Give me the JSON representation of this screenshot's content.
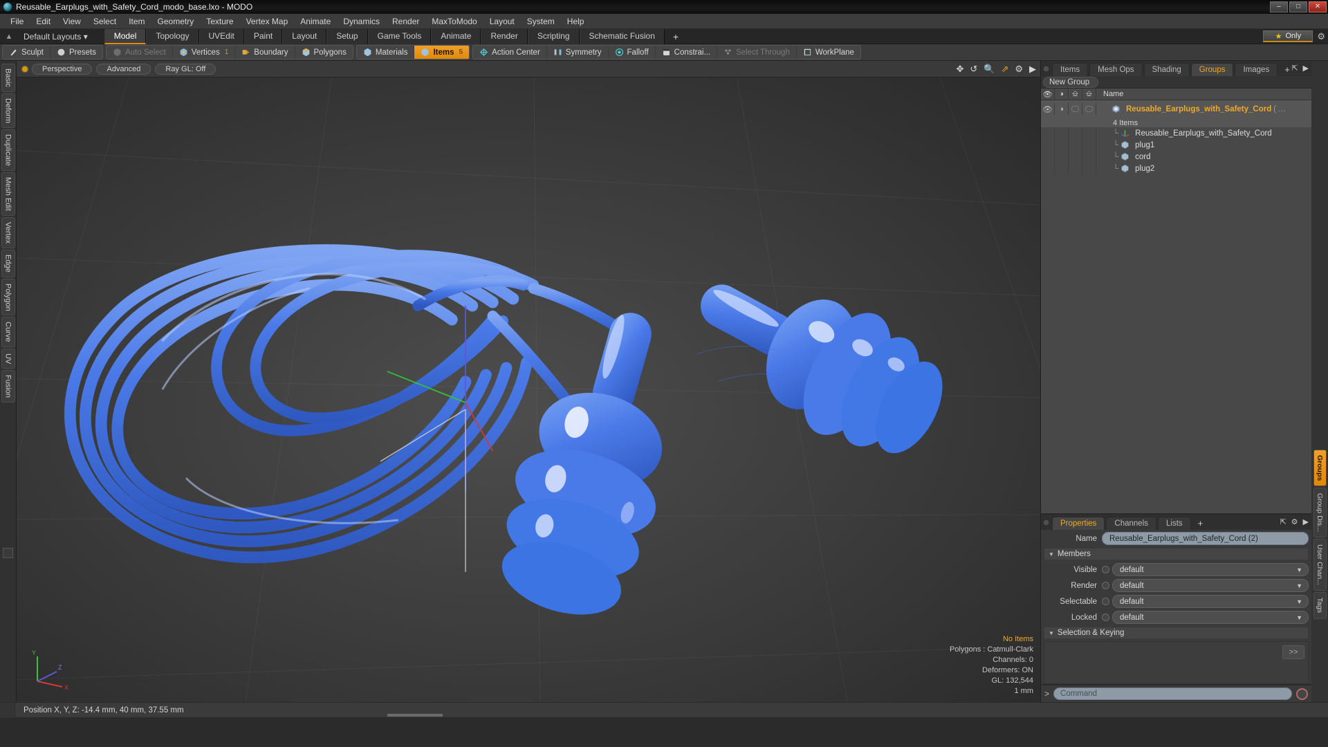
{
  "window": {
    "title": "Reusable_Earplugs_with_Safety_Cord_modo_base.lxo - MODO",
    "app_icon": "modo-logo-icon",
    "buttons": {
      "minimize": "–",
      "maximize": "□",
      "close": "✕"
    }
  },
  "menubar": {
    "items": [
      "File",
      "Edit",
      "View",
      "Select",
      "Item",
      "Geometry",
      "Texture",
      "Vertex Map",
      "Animate",
      "Dynamics",
      "Render",
      "MaxToModo",
      "Layout",
      "System",
      "Help"
    ]
  },
  "layoutbar": {
    "anchor_icon": "anchor-pin-icon",
    "default_layouts": "Default Layouts",
    "dropdown_caret": "▾",
    "tabs": [
      {
        "label": "Model",
        "active": true
      },
      {
        "label": "Topology",
        "active": false
      },
      {
        "label": "UVEdit",
        "active": false
      },
      {
        "label": "Paint",
        "active": false
      },
      {
        "label": "Layout",
        "active": false
      },
      {
        "label": "Setup",
        "active": false
      },
      {
        "label": "Game Tools",
        "active": false
      },
      {
        "label": "Animate",
        "active": false
      },
      {
        "label": "Render",
        "active": false
      },
      {
        "label": "Scripting",
        "active": false
      },
      {
        "label": "Schematic Fusion",
        "active": false
      }
    ],
    "add_tab": "+",
    "only_button": {
      "label": "Only",
      "icon": "star-icon"
    },
    "settings_icon": "gear-icon"
  },
  "modebar": {
    "group1": [
      {
        "label": "Sculpt",
        "icon": "brush-icon",
        "state": "normal"
      },
      {
        "label": "Presets",
        "icon": "sphere-icon",
        "state": "normal"
      }
    ],
    "group2": [
      {
        "label": "Auto Select",
        "icon": "cube-grey-icon",
        "state": "disabled",
        "num": ""
      },
      {
        "label": "Vertices",
        "icon": "cube-vertex-icon",
        "state": "normal",
        "num": "1"
      },
      {
        "label": "Boundary",
        "icon": "cube-boundary-icon",
        "state": "normal",
        "num": ""
      },
      {
        "label": "Polygons",
        "icon": "cube-poly-icon",
        "state": "normal",
        "num": ""
      }
    ],
    "group3": [
      {
        "label": "Materials",
        "icon": "cube-material-icon",
        "state": "normal",
        "num": ""
      },
      {
        "label": "Items",
        "icon": "cube-items-icon",
        "state": "active",
        "num": "5"
      }
    ],
    "group4": [
      {
        "label": "Action Center",
        "icon": "action-center-icon",
        "state": "normal"
      },
      {
        "label": "Symmetry",
        "icon": "symmetry-icon",
        "state": "normal"
      },
      {
        "label": "Falloff",
        "icon": "falloff-icon",
        "state": "normal"
      },
      {
        "label": "Constrai...",
        "icon": "constraint-icon",
        "state": "normal"
      },
      {
        "label": "Select Through",
        "icon": "select-through-icon",
        "state": "disabled"
      },
      {
        "label": "WorkPlane",
        "icon": "workplane-icon",
        "state": "normal"
      }
    ]
  },
  "left_rail": {
    "tabs": [
      "Basic",
      "Deform",
      "Duplicate",
      "Mesh Edit",
      "Vertex",
      "Edge",
      "Polygon",
      "Curve",
      "UV",
      "Fusion"
    ]
  },
  "viewport": {
    "pills": [
      "Perspective",
      "Advanced",
      "Ray GL: Off"
    ],
    "indicator_icon": "viewport-state-dot",
    "header_icons": [
      "move-icon",
      "rotate-icon",
      "zoom-icon",
      "fit-icon",
      "gear-icon",
      "chevron-right-icon"
    ],
    "stats": {
      "selection": "No Items",
      "polygons": "Polygons : Catmull-Clark",
      "channels": "Channels: 0",
      "deformers": "Deformers: ON",
      "gl": "GL: 132,544",
      "unit": "1 mm"
    },
    "axis_gizmo": {
      "x": "X",
      "y": "Y",
      "z": "Z"
    },
    "model_description": "Blue reusable earplugs with coiled safety cord, 3D shaded viewport render"
  },
  "right_panel": {
    "tabs": [
      {
        "label": "Items",
        "active": false
      },
      {
        "label": "Mesh Ops",
        "active": false
      },
      {
        "label": "Shading",
        "active": false
      },
      {
        "label": "Groups",
        "active": true
      },
      {
        "label": "Images",
        "active": false
      }
    ],
    "add_tab": "+",
    "header_icons": [
      "expand-icon",
      "chevron-right-icon"
    ],
    "new_group_button": "New Group",
    "tree_header": {
      "columns": [
        "eye-icon",
        "render-icon",
        "lock-icon",
        "select-icon"
      ],
      "name": "Name"
    },
    "tree_rows": [
      {
        "label": "Reusable_Earplugs_with_Safety_Cord",
        "suffix": "(",
        "icon": "group-icon",
        "selected": true,
        "indent": 0,
        "subtitle": "4 Items"
      },
      {
        "label": "Reusable_Earplugs_with_Safety_Cord",
        "icon": "locator-axis-icon",
        "selected": false,
        "indent": 1
      },
      {
        "label": "plug1",
        "icon": "mesh-icon",
        "selected": false,
        "indent": 1
      },
      {
        "label": "cord",
        "icon": "mesh-icon",
        "selected": false,
        "indent": 1
      },
      {
        "label": "plug2",
        "icon": "mesh-icon",
        "selected": false,
        "indent": 1
      }
    ]
  },
  "properties": {
    "tabs": [
      {
        "label": "Properties",
        "active": true
      },
      {
        "label": "Channels",
        "active": false
      },
      {
        "label": "Lists",
        "active": false
      }
    ],
    "add_tab": "+",
    "header_icons": [
      "expand-icon",
      "gear-icon",
      "chevron-right-icon"
    ],
    "name_label": "Name",
    "name_value": "Reusable_Earplugs_with_Safety_Cord (2)",
    "members_section": "Members",
    "fields": [
      {
        "label": "Visible",
        "value": "default"
      },
      {
        "label": "Render",
        "value": "default"
      },
      {
        "label": "Selectable",
        "value": "default"
      },
      {
        "label": "Locked",
        "value": "default"
      }
    ],
    "selection_section": "Selection & Keying",
    "go_button": ">>"
  },
  "right_rail": {
    "tabs": [
      {
        "label": "Groups",
        "active": true
      },
      {
        "label": "Group Dis...",
        "active": false
      },
      {
        "label": "User Chan...",
        "active": false
      },
      {
        "label": "Tags",
        "active": false
      }
    ]
  },
  "command_bar": {
    "prompt": ">",
    "placeholder": "Command",
    "record_icon": "record-icon"
  },
  "status_bar": {
    "text": "Position X, Y, Z:   -14.4 mm, 40 mm, 37.55 mm"
  },
  "colors": {
    "accent_orange": "#e8a317",
    "model_blue": "#4a7fe8",
    "panel_bg": "#3a3a3a",
    "tree_bg": "#484848"
  }
}
